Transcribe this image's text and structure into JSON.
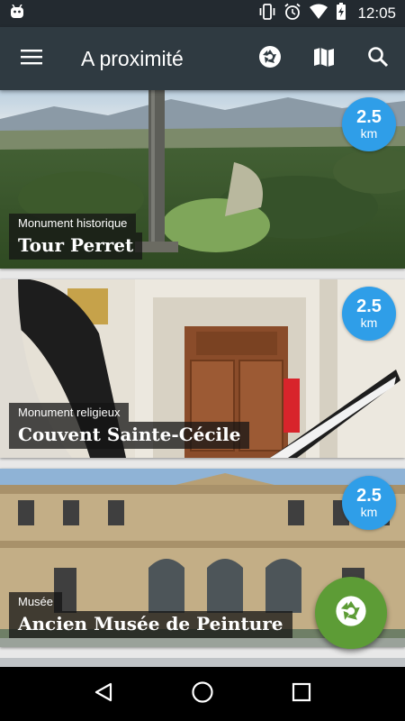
{
  "status_bar": {
    "time": "12:05",
    "icons": [
      "android-icon",
      "vibrate-icon",
      "alarm-icon",
      "wifi-icon",
      "battery-charging-icon"
    ]
  },
  "app_bar": {
    "title": "A proximité",
    "actions": [
      "camera-aperture-icon",
      "map-icon",
      "search-icon"
    ]
  },
  "places": [
    {
      "category": "Monument historique",
      "name": "Tour Perret",
      "distance": "2.5",
      "unit": "km"
    },
    {
      "category": "Monument religieux",
      "name": "Couvent Sainte-Cécile",
      "distance": "2.5",
      "unit": "km"
    },
    {
      "category": "Musée",
      "name": "Ancien Musée de Peinture",
      "distance": "2.5",
      "unit": "km"
    }
  ],
  "colors": {
    "status_bar": "#232a30",
    "app_bar": "#2f3a41",
    "distance_badge": "#2f9ee8",
    "fab": "#5d9c36"
  },
  "fab": {
    "icon": "camera-aperture-icon"
  },
  "nav_bar": {
    "buttons": [
      "back-icon",
      "home-icon",
      "recents-icon"
    ]
  }
}
